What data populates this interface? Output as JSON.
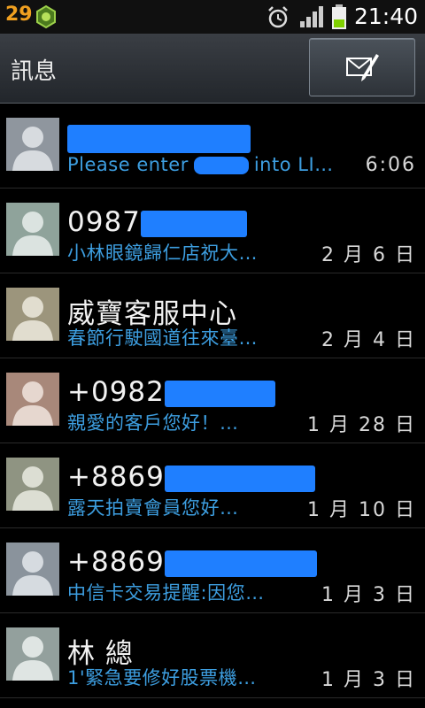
{
  "status_bar": {
    "notification_count": "29",
    "time": "21:40",
    "icons": [
      "app-badge-icon",
      "alarm-icon",
      "signal-icon",
      "battery-icon"
    ]
  },
  "header": {
    "title": "訊息",
    "compose_icon": "compose-message-icon"
  },
  "threads": [
    {
      "name": "",
      "preview_prefix": "Please enter",
      "preview_suffix": "into LI…",
      "date": "6:06",
      "avatar_color": "#8f969e"
    },
    {
      "name": "0987",
      "preview": "小林眼鏡歸仁店祝大…",
      "date": "2 月 6 日",
      "avatar_color": "#8fa39b"
    },
    {
      "name": "威寶客服中心",
      "preview": "春節行駛國道往來臺…",
      "date": "2 月 4 日",
      "avatar_color": "#9c957c"
    },
    {
      "name": "+0982",
      "preview": "親愛的客戶您好！…",
      "date": "1 月 28 日",
      "avatar_color": "#a8887a"
    },
    {
      "name": "+8869",
      "preview": "露天拍賣會員您好…",
      "date": "1 月 10 日",
      "avatar_color": "#8f9482"
    },
    {
      "name": "+8869",
      "preview": "中信卡交易提醒:因您…",
      "date": "1 月 3 日",
      "avatar_color": "#8a939c"
    },
    {
      "name": "林 總",
      "preview": "1'緊急要修好股票機…",
      "date": "1 月 3 日",
      "avatar_color": "#93a09d"
    }
  ]
}
